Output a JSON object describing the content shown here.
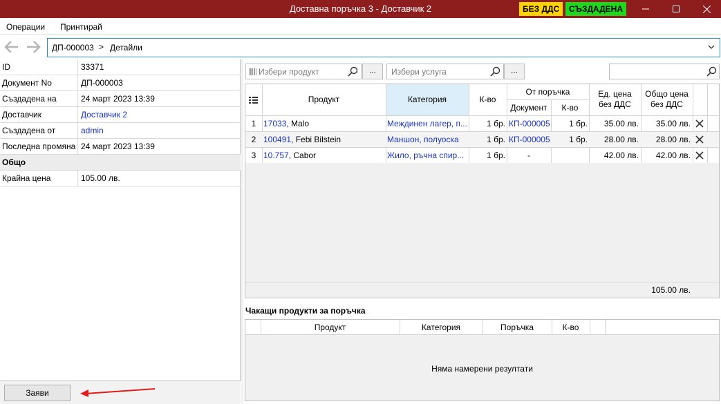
{
  "window": {
    "title": "Доставна поръчка 3 - Доставчик 2",
    "badge_vat": "БЕЗ ДДС",
    "badge_status": "СЪЗДАДЕНА",
    "badge_vat_color": "#ffd400",
    "badge_status_color": "#1ed81e",
    "title_bar_color": "#8e1d1d"
  },
  "menu": {
    "operations": "Операции",
    "print": "Принтирай"
  },
  "breadcrumb": {
    "document": "ДП-000003",
    "separator": ">",
    "page": "Детайли"
  },
  "details": {
    "rows": [
      {
        "label": "ID",
        "value": "33371"
      },
      {
        "label": "Документ No",
        "value": "ДП-000003"
      },
      {
        "label": "Създадена на",
        "value": "24 март 2023 13:39"
      },
      {
        "label": "Доставчик",
        "value": "Доставчик 2"
      },
      {
        "label": "Създадена от",
        "value": "admin"
      },
      {
        "label": "Последна промяна",
        "value": "24 март 2023 13:39"
      }
    ],
    "group_total": "Общо",
    "total_row": {
      "label": "Крайна цена",
      "value": "105.00 лв."
    },
    "submit_button": "Заяви"
  },
  "toolbar": {
    "product_placeholder": "Избери продукт",
    "service_placeholder": "Избери услуга",
    "ellipsis": "...",
    "search_value": ""
  },
  "items_table": {
    "headers": {
      "product": "Продукт",
      "category": "Категория",
      "qty": "К-во",
      "from_order": "От поръчка",
      "document": "Документ",
      "order_qty": "К-во",
      "unit_price_1": "Ед. цена",
      "unit_price_2": "без ДДС",
      "total_price_1": "Общо цена",
      "total_price_2": "без ДДС"
    },
    "rows": [
      {
        "num": "1",
        "code": "17033",
        "name": ", Malo",
        "category": "Междинен лагер, п...",
        "qty": "1 бр.",
        "document": "КП-000005",
        "order_qty": "1 бр.",
        "unit_price": "35.00 лв.",
        "total": "35.00 лв."
      },
      {
        "num": "2",
        "code": "100491",
        "name": ", Febi Bilstein",
        "category": "Маншон, полуоска",
        "qty": "1 бр.",
        "document": "КП-000005",
        "order_qty": "1 бр.",
        "unit_price": "28.00 лв.",
        "total": "28.00 лв."
      },
      {
        "num": "3",
        "code": "10.757",
        "name": ", Cabor",
        "category": "Жило, ръчна спир...",
        "qty": "1 бр.",
        "document": "-",
        "order_qty": "",
        "unit_price": "42.00 лв.",
        "total": "42.00 лв."
      }
    ],
    "footer_total": "105.00 лв."
  },
  "pending": {
    "title": "Чакащи продукти за поръчка",
    "headers": {
      "product": "Продукт",
      "category": "Категория",
      "order": "Поръчка",
      "qty": "К-во"
    },
    "empty_message": "Няма намерени резултати"
  }
}
